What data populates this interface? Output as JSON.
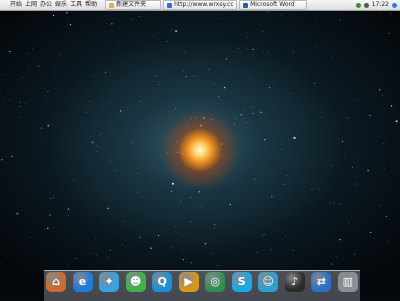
{
  "menubar": {
    "apple_icon": "apple-logo",
    "menus": [
      "开始",
      "上网",
      "办公",
      "娱乐",
      "工具",
      "帮助"
    ],
    "tasks": [
      {
        "label": "新建文件夹",
        "icon_color": "#e0b03a"
      },
      {
        "label": "http://www.wrxsy.com",
        "icon_color": "#2f6fd6"
      },
      {
        "label": "Microsoft Word",
        "icon_color": "#2a5aa8"
      }
    ],
    "clock": "17:22"
  },
  "dock": {
    "items": [
      {
        "name": "home",
        "icon": "home-icon",
        "color": "#c96b2b"
      },
      {
        "name": "internet-explorer",
        "icon": "ie-icon",
        "color": "#1e7bd8"
      },
      {
        "name": "safari",
        "icon": "compass-icon",
        "color": "#3aa0e0"
      },
      {
        "name": "msn-messenger",
        "icon": "buddies-icon",
        "color": "#3fb24a"
      },
      {
        "name": "qq",
        "icon": "penguin-icon",
        "color": "#1a8fd8"
      },
      {
        "name": "media-player",
        "icon": "play-icon",
        "color": "#d8961a"
      },
      {
        "name": "globe",
        "icon": "globe-icon",
        "color": "#2f8f4f"
      },
      {
        "name": "skype",
        "icon": "skype-icon",
        "color": "#1aa8e8"
      },
      {
        "name": "chat",
        "icon": "chat-icon",
        "color": "#2c9fd2"
      },
      {
        "name": "music",
        "icon": "music-icon",
        "color": "#2a2a2a"
      },
      {
        "name": "network",
        "icon": "network-icon",
        "color": "#2b6fc8"
      },
      {
        "name": "trash",
        "icon": "trash-icon",
        "color": "#8a8f96"
      }
    ]
  }
}
